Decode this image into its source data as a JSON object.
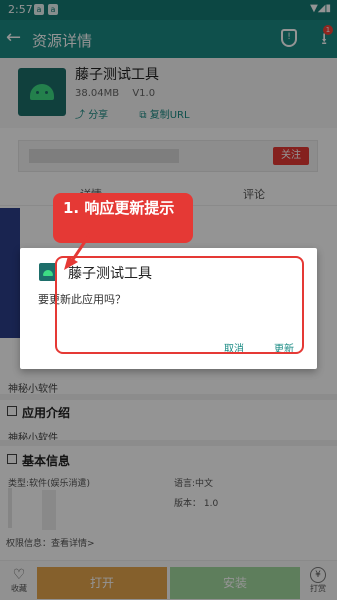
{
  "status_bar": {
    "time": "2:57",
    "notif1": "a",
    "notif2": "a"
  },
  "app_bar": {
    "title": "资源详情",
    "badge": "1"
  },
  "app": {
    "name": "藤子测试工具",
    "size": "38.04MB",
    "version": "V1.0",
    "share": "分享",
    "copy_url": "复制URL"
  },
  "follow_label": "关注",
  "tabs": [
    "详情",
    "评论"
  ],
  "sections": {
    "hidden_title_tag": "神秘小软件",
    "intro_title": "应用介绍",
    "intro_text": "神秘小软件",
    "basic_title": "基本信息",
    "type": "类型:软件(娱乐消遣)",
    "language": "语言:中文",
    "version": "版本： 1.0",
    "permission": "权限信息：查看详情>"
  },
  "bottom": {
    "fav": "收藏",
    "open": "打开",
    "install": "安装",
    "reward": "打赏"
  },
  "dialog": {
    "title": "藤子测试工具",
    "message": "要更新此应用吗？",
    "cancel": "取消",
    "update": "更新"
  },
  "annotation": {
    "text": "1. 响应更新提示"
  },
  "colors": {
    "primary": "#1a8b84",
    "status_bar": "#157a74",
    "annotation": "#e53935",
    "open_button": "#e6a54d",
    "install_button": "#a2d99f"
  }
}
